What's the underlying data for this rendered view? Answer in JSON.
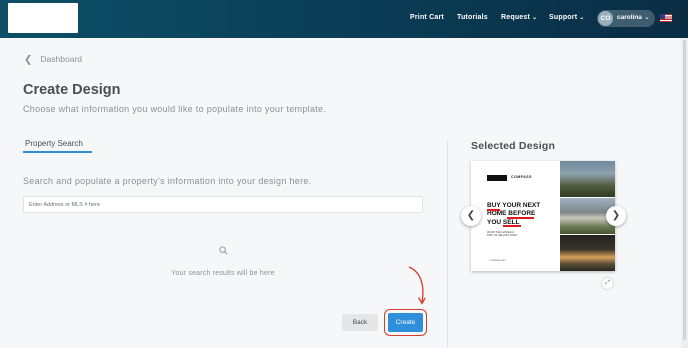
{
  "header": {
    "nav": [
      {
        "label": "Print Cart"
      },
      {
        "label": "Tutorials"
      },
      {
        "label": "Request"
      },
      {
        "label": "Support"
      }
    ],
    "user": {
      "initials": "CO",
      "name": "carolina"
    },
    "flag_icon": "us-flag-icon"
  },
  "breadcrumb": {
    "label": "Dashboard"
  },
  "page": {
    "title": "Create Design",
    "subtitle": "Choose what information you would like to populate into your template."
  },
  "tabs": [
    {
      "label": "Property Search"
    }
  ],
  "search": {
    "hint": "Search and populate a property's information into your design here.",
    "placeholder": "Enter Address or MLS # here",
    "value": "",
    "empty_text": "Your search results will be here"
  },
  "actions": {
    "back_label": "Back",
    "create_label": "Create"
  },
  "selected_design": {
    "title": "Selected Design",
    "template": {
      "brand": "COMPASS",
      "headline": "BUY YOUR NEXT\nHOME BEFORE\nYOU SELL",
      "subtext": "AVOID THE HASSLE &\nRISK OF SELLING FIRST",
      "footer": "→ compass.com"
    }
  },
  "colors": {
    "header_bg": "#0b3f59",
    "accent": "#2f8fdb",
    "annotation_red": "#d93a2b"
  }
}
